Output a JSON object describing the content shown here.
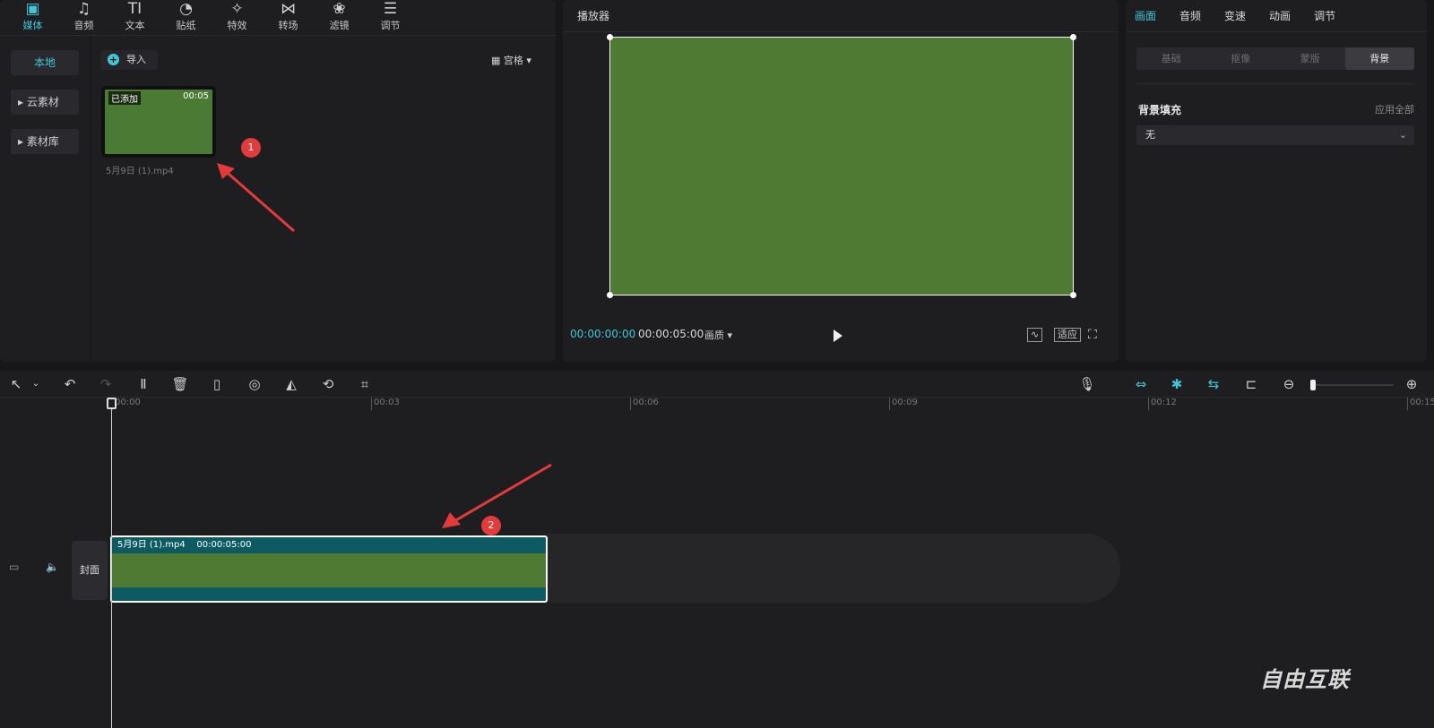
{
  "media_tabs": [
    {
      "label": "媒体",
      "icon": "▣",
      "active": true
    },
    {
      "label": "音频",
      "icon": "♫"
    },
    {
      "label": "文本",
      "icon": "TI"
    },
    {
      "label": "贴纸",
      "icon": "◔"
    },
    {
      "label": "特效",
      "icon": "✧"
    },
    {
      "label": "转场",
      "icon": "⋈"
    },
    {
      "label": "滤镜",
      "icon": "❀"
    },
    {
      "label": "调节",
      "icon": "☰"
    }
  ],
  "sidebar": {
    "items": [
      "本地",
      "▸ 云素材",
      "▸ 素材库"
    ]
  },
  "import_label": "导入",
  "view_label": "宫格",
  "media_item": {
    "added": "已添加",
    "duration": "00:05",
    "filename": "5月9日 (1).mp4"
  },
  "badges": [
    "1",
    "2"
  ],
  "player": {
    "title": "播放器",
    "current": "00:00:00:00",
    "total": "00:00:05:00",
    "quality": "画质",
    "fit_label": "适应"
  },
  "props": {
    "tabs": [
      "画面",
      "音频",
      "变速",
      "动画",
      "调节"
    ],
    "segments": [
      "基础",
      "抠像",
      "蒙版",
      "背景"
    ],
    "bg_fill_label": "背景填充",
    "apply_all": "应用全部",
    "select_value": "无"
  },
  "timeline": {
    "ticks": [
      "00:00",
      "00:03",
      "00:06",
      "00:09",
      "00:12",
      "00:15"
    ],
    "clip_name": "5月9日 (1).mp4",
    "clip_duration": "00:00:05:00",
    "cover_label": "封面"
  },
  "watermark": "自由互联"
}
